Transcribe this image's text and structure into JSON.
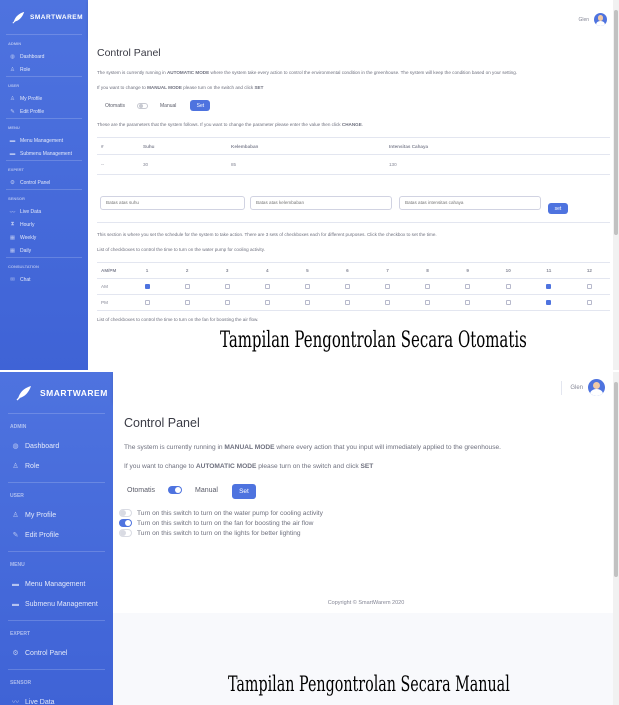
{
  "colors": {
    "primary": "#4e73df",
    "text": "#5a5c69",
    "muted": "#858796"
  },
  "icons": {
    "brand": "leaf-icon",
    "avatar": "user-avatar-icon"
  },
  "brand": {
    "name": "SMARTWAREM"
  },
  "sidebar": {
    "headings": {
      "admin": "ADMIN",
      "user": "USER",
      "menu": "MENU",
      "expert": "EXPERT",
      "sensor": "SENSOR",
      "consultation": "CONSULTATION"
    },
    "items": {
      "dashboard": "Dashboard",
      "role": "Role",
      "my_profile": "My Profile",
      "edit_profile": "Edit Profile",
      "menu_management": "Menu Management",
      "submenu_management": "Submenu Management",
      "control_panel": "Control Panel",
      "live_data": "Live Data",
      "hourly": "Hourly",
      "weekly": "Weekly",
      "daily": "Daily",
      "chat": "Chat"
    }
  },
  "topbar": {
    "user_name": "Glen"
  },
  "auto": {
    "title": "Control Panel",
    "status_text_1": "The system is currently running in ",
    "status_mode": "AUTOMATIC MODE",
    "status_text_2": " where the system take every action to control the environmental condition in the greenhouse. The system will keep the condition based on your setting.",
    "switch_text_1": "If you want to change to ",
    "switch_mode": "MANUAL MODE",
    "switch_text_2": " please turn on the switch and click ",
    "switch_set": "SET",
    "mode_auto_label": "Otomatis",
    "mode_manual_label": "Manual",
    "set_button": "Set",
    "params_text_1": "These are the parameters that the system follows. If you want to change the parameter please enter the value then click ",
    "params_change": "CHANGE",
    "params_text_2": ".",
    "param_headers": [
      "#",
      "Suhu",
      "Kelembaban",
      "Intensitas Cahaya"
    ],
    "param_row": [
      "--",
      "30",
      "85",
      "130"
    ],
    "inputs": {
      "temp_placeholder": "Batas atas suhu",
      "humidity_placeholder": "Batas atas kelembaban",
      "light_placeholder": "Batas atas intensitas cahaya"
    },
    "set_button_2": "set",
    "schedule_text": "This section is where you set the schedule for the system to take action. There are 3 sets of checkboxes each for different purposes. Click the checkbox to set the time.",
    "pump_text": "List of checkboxes to control the time to turn on the water pump for cooling activity.",
    "hour_headers": [
      "AM/PM",
      "1",
      "2",
      "3",
      "4",
      "5",
      "6",
      "7",
      "8",
      "9",
      "10",
      "11",
      "12"
    ],
    "rows": [
      {
        "label": "AM",
        "checked": [
          true,
          false,
          false,
          false,
          false,
          false,
          false,
          false,
          false,
          false,
          true,
          false
        ]
      },
      {
        "label": "PM",
        "checked": [
          false,
          false,
          false,
          false,
          false,
          false,
          false,
          false,
          false,
          false,
          true,
          false
        ]
      }
    ],
    "fan_text": "List of checkboxes to control the time to turn on the fan for boosting the air flow."
  },
  "manual": {
    "title": "Control Panel",
    "status_text_1": "The system is currently running in ",
    "status_mode": "MANUAL MODE",
    "status_text_2": " where every action that you input will immediately applied to the greenhouse.",
    "switch_text_1": "If you want to change to ",
    "switch_mode": "AUTOMATIC MODE",
    "switch_text_2": " please turn on the switch and click ",
    "switch_set": "SET",
    "mode_auto_label": "Otomatis",
    "mode_manual_label": "Manual",
    "set_button": "Set",
    "switches": [
      {
        "label": "Turn on this switch to turn on the water pump for cooling activity",
        "on": false
      },
      {
        "label": "Turn on this switch to turn on the fan for boosting the air flow",
        "on": true
      },
      {
        "label": "Turn on this switch to turn on the lights for better lighting",
        "on": false
      }
    ],
    "footer": "Copyright © SmartWarem 2020"
  },
  "captions": {
    "auto": "Tampilan Pengontrolan Secara Otomatis",
    "manual": "Tampilan Pengontrolan Secara Manual"
  }
}
